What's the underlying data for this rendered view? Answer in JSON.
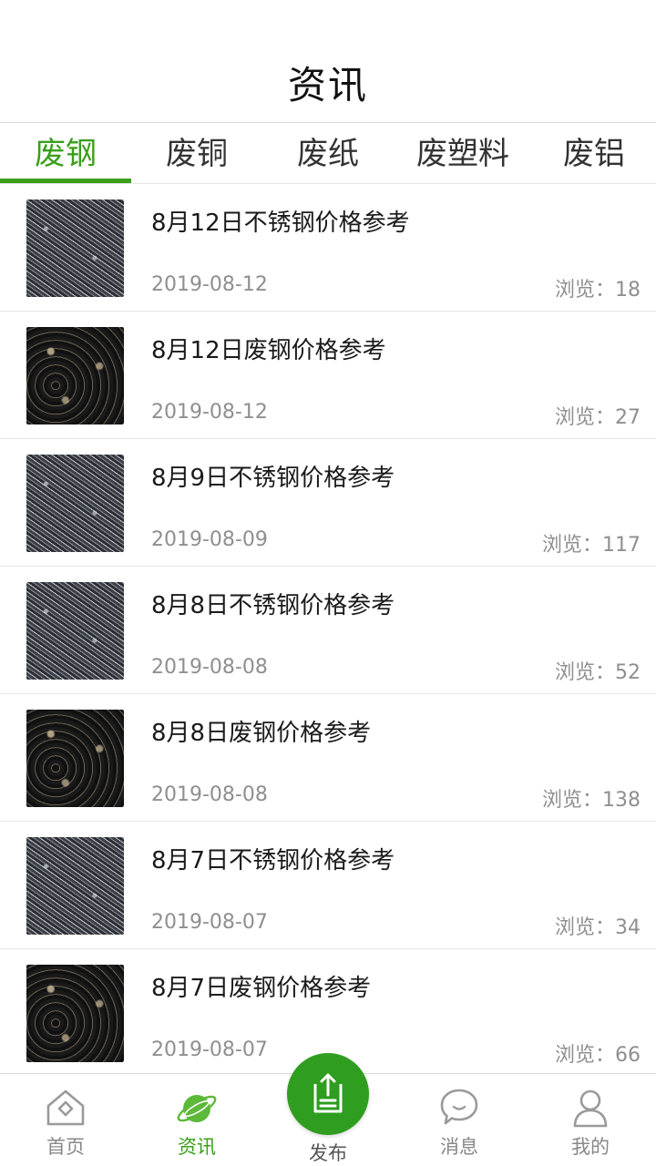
{
  "header": {
    "title": "资讯"
  },
  "tabs": [
    {
      "label": "废钢",
      "active": true
    },
    {
      "label": "废铜",
      "active": false
    },
    {
      "label": "废纸",
      "active": false
    },
    {
      "label": "废塑料",
      "active": false
    },
    {
      "label": "废铝",
      "active": false
    }
  ],
  "articles": [
    {
      "title": "8月12日不锈钢价格参考",
      "date": "2019-08-12",
      "views": "浏览：18",
      "thumb": "stainless"
    },
    {
      "title": "8月12日废钢价格参考",
      "date": "2019-08-12",
      "views": "浏览：27",
      "thumb": "steel"
    },
    {
      "title": "8月9日不锈钢价格参考",
      "date": "2019-08-09",
      "views": "浏览：117",
      "thumb": "stainless"
    },
    {
      "title": "8月8日不锈钢价格参考",
      "date": "2019-08-08",
      "views": "浏览：52",
      "thumb": "stainless"
    },
    {
      "title": "8月8日废钢价格参考",
      "date": "2019-08-08",
      "views": "浏览：138",
      "thumb": "steel"
    },
    {
      "title": "8月7日不锈钢价格参考",
      "date": "2019-08-07",
      "views": "浏览：34",
      "thumb": "stainless"
    },
    {
      "title": "8月7日废钢价格参考",
      "date": "2019-08-07",
      "views": "浏览：66",
      "thumb": "steel"
    }
  ],
  "bottom_nav": {
    "home": "首页",
    "news": "资讯",
    "publish": "发布",
    "messages": "消息",
    "mine": "我的"
  },
  "colors": {
    "accent": "#3a9f1a",
    "publish_button": "#2f9d1f"
  }
}
